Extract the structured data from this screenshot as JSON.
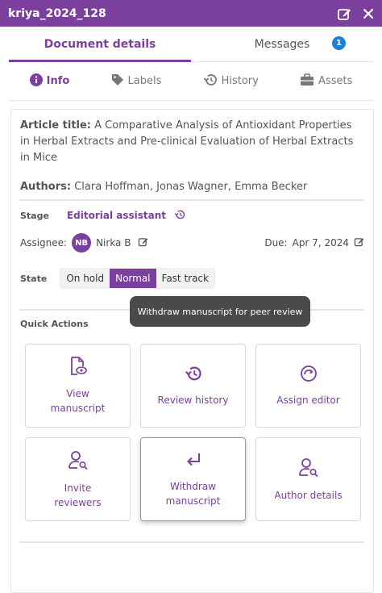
{
  "window": {
    "title": "kriya_2024_128"
  },
  "main_tabs": [
    {
      "label": "Document details"
    },
    {
      "label": "Messages",
      "badge": "1"
    }
  ],
  "sub_tabs": [
    {
      "label": "Info",
      "icon": "info-icon"
    },
    {
      "label": "Labels",
      "icon": "tag-icon"
    },
    {
      "label": "History",
      "icon": "history-icon"
    },
    {
      "label": "Assets",
      "icon": "briefcase-icon"
    }
  ],
  "article": {
    "title_label": "Article title:",
    "title": "A Comparative Analysis of Antioxidant Properties in Herbal Extracts and Pre-clinical Evaluation of Herbal Extracts in Mice",
    "authors_label": "Authors:",
    "authors": "Clara Hoffman, Jonas Wagner, Emma Becker"
  },
  "workflow": {
    "stage_label": "Stage",
    "stage_value": "Editorial assistant",
    "assignee_label": "Assignee:",
    "assignee_initials": "NB",
    "assignee_name": "Nirka B",
    "due_label": "Due:",
    "due_value": "Apr 7, 2024",
    "state_label": "State",
    "states": [
      "On hold",
      "Normal",
      "Fast track"
    ],
    "selected_state": "Normal"
  },
  "quick_actions": {
    "title": "Quick Actions",
    "tiles": [
      {
        "label": "View manuscript",
        "icon": "file-eye-icon"
      },
      {
        "label": "Review history",
        "icon": "history-icon"
      },
      {
        "label": "Assign editor",
        "icon": "circle-arrow-icon"
      },
      {
        "label": "Invite reviewers",
        "icon": "user-search-icon"
      },
      {
        "label": "Withdraw manuscript",
        "icon": "return-arrow-icon"
      },
      {
        "label": "Author details",
        "icon": "user-search-icon"
      }
    ],
    "tooltip": "Withdraw manuscript for peer review"
  },
  "colors": {
    "accent": "#7b3f9e",
    "badge": "#1e7fd6"
  }
}
